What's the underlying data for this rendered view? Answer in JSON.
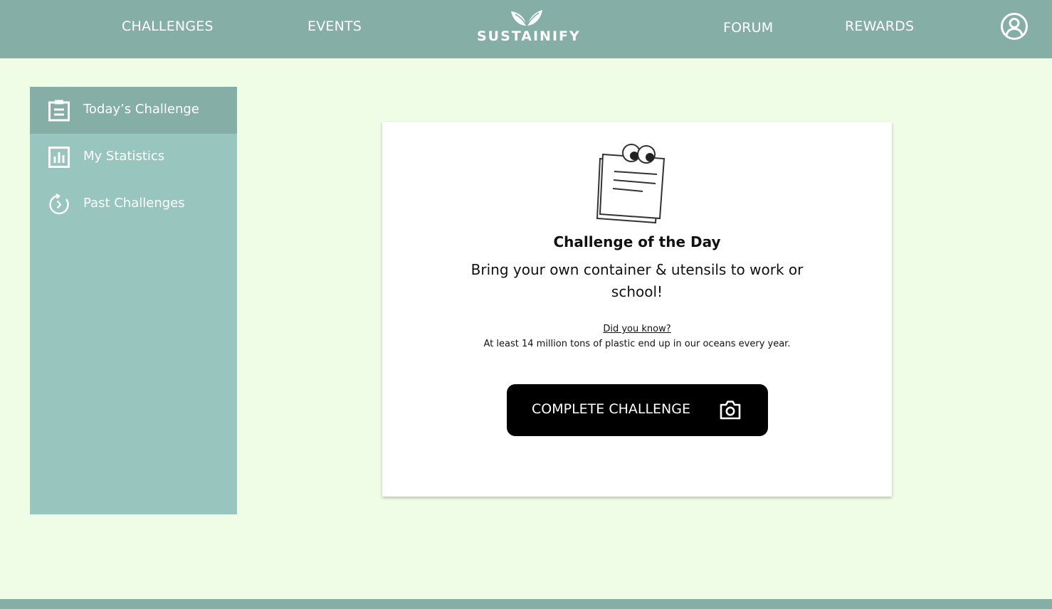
{
  "header": {
    "nav": {
      "challenges": "CHALLENGES",
      "events": "EVENTS",
      "forum": "FORUM",
      "rewards": "REWARDS"
    },
    "logo_text": "SUSTAINIFY",
    "profile_icon": "user-circle-icon"
  },
  "sidebar": {
    "items": [
      {
        "label": "Today’s Challenge",
        "icon": "clipboard-icon",
        "active": true
      },
      {
        "label": "My Statistics",
        "icon": "bar-chart-icon",
        "active": false
      },
      {
        "label": "Past Challenges",
        "icon": "history-timer-icon",
        "active": false
      }
    ]
  },
  "challenge": {
    "title": "Challenge of the Day",
    "text": "Bring your own container & utensils to work or school!",
    "fact_title": "Did you know?",
    "fact_text": "At least 14 million tons of plastic end up in our oceans every year.",
    "button_label": "COMPLETE CHALLENGE",
    "button_icon": "camera-icon"
  },
  "colors": {
    "header_bg": "#85aea6",
    "page_bg": "#f0fde6",
    "sidebar_bg": "#98c5be",
    "sidebar_active_bg": "#85aea6",
    "button_bg": "#000000"
  }
}
